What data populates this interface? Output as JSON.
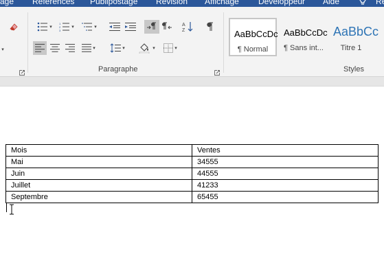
{
  "ribbon_tabs": [
    "age",
    "Références",
    "Publipostage",
    "Révision",
    "Affichage",
    "Développeur",
    "Aide",
    "Re"
  ],
  "paragraph_group": {
    "label": "Paragraphe"
  },
  "styles_group": {
    "label": "Styles",
    "tiles": [
      {
        "preview": "AaBbCcDc",
        "name": "¶ Normal",
        "selected": true
      },
      {
        "preview": "AaBbCcDc",
        "name": "¶ Sans int...",
        "selected": false
      },
      {
        "preview": "AaBbCc",
        "name": "Titre 1",
        "selected": false
      }
    ]
  },
  "table": {
    "rows": [
      [
        "Mois",
        "Ventes"
      ],
      [
        "Mai",
        "34555"
      ],
      [
        "Juin",
        "44555"
      ],
      [
        "Juillet",
        "41233"
      ],
      [
        "Septembre",
        "65455"
      ]
    ]
  },
  "colors": {
    "ribbon_tab_bar": "#2b579a",
    "ribbon_bg": "#f3f3f3",
    "title_style_blue": "#2e74b5",
    "active_button": "#c8c8c8"
  }
}
